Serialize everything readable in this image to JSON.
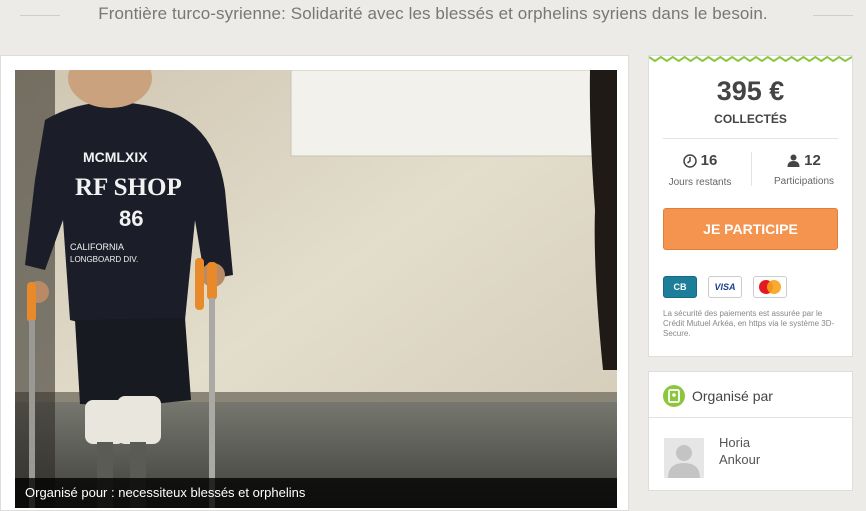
{
  "page": {
    "title": "Frontière turco-syrienne: Solidarité avec les blessés et orphelins syriens dans le besoin."
  },
  "media": {
    "caption": "Organisé pour : necessiteux blessés et orphelins",
    "shirt_text": [
      "MCMLXIX",
      "RF SHOP",
      "86",
      "CALIFORNIA",
      "LONGBOARD DIV."
    ]
  },
  "funding": {
    "amount": "395 €",
    "amount_label": "COLLECTÉS",
    "days_value": "16",
    "days_label": "Jours restants",
    "days_icon": "clock-icon",
    "participants_value": "12",
    "participants_label": "Participations",
    "participants_icon": "user-icon",
    "cta_label": "JE PARTICIPE",
    "cta_color": "#f4944f",
    "payment_methods": [
      "CB",
      "VISA",
      "MasterCard"
    ],
    "security_note": "La sécurité des paiements est assurée par le Crédit Mutuel Arkéa, en https via le système 3D-Secure."
  },
  "organizer": {
    "heading": "Organisé par",
    "first_name": "Horia",
    "last_name": "Ankour",
    "accent_color": "#8cc63e"
  }
}
